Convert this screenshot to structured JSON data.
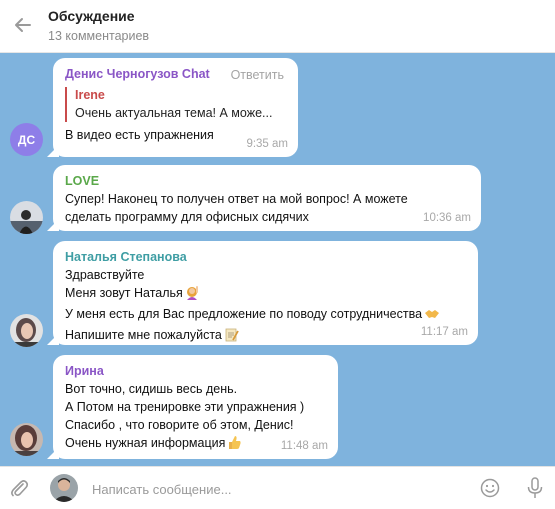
{
  "header": {
    "title": "Обсуждение",
    "subtitle": "13 комментариев"
  },
  "messages": [
    {
      "sender": "Денис Черногузов Chat",
      "sender_color": "#8a56c6",
      "avatar_initials": "ДС",
      "reply_label": "Ответить",
      "quote_name": "Irene",
      "quote_text": "Очень актуальная тема! А може...",
      "lines": [
        "В видео есть упражнения"
      ],
      "time": "9:35 am"
    },
    {
      "sender": "LOVE",
      "sender_color": "#5aa84a",
      "lines": [
        "Супер! Наконец то получен ответ на мой вопрос! А можете",
        "сделать программу для офисных сидячих"
      ],
      "time": "10:36 am"
    },
    {
      "sender": "Наталья Степанова",
      "sender_color": "#3f9ea4",
      "lines": [
        "Здравствуйте",
        "Меня зовут Наталья",
        "У меня есть для Вас предложение по поводу сотрудничества",
        "Напишите мне пожалуйста"
      ],
      "emojis": [
        "woman-raising-hand-emoji",
        "handshake-emoji",
        "memo-emoji"
      ],
      "time": "11:17 am"
    },
    {
      "sender": "Ирина",
      "sender_color": "#8a56c6",
      "lines": [
        "Вот точно, сидишь весь день.",
        "А Потом на тренировке эти упражнения )",
        "Спасибо , что говорите об этом, Денис!",
        "Очень нужная информация"
      ],
      "emojis": [
        "thumbs-up-emoji"
      ],
      "time": "11:48 am"
    }
  ],
  "composer": {
    "placeholder": "Написать сообщение..."
  },
  "colors": {
    "chat_background": "#7fb3dd",
    "quote_accent": "#c94b4b"
  }
}
